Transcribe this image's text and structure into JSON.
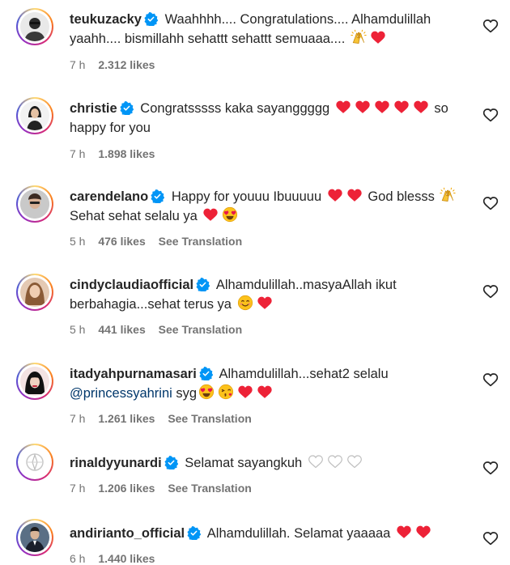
{
  "comments": [
    {
      "username": "teukuzacky",
      "text": "Waahhhh.... Congratulations.... Alhamdulillah yaahh.... bismillahh sehattt sehattt semuaaa....",
      "time": "7 h",
      "likes": "2.312 likes",
      "emoji": [
        "raised-hands",
        "heart"
      ]
    },
    {
      "username": "christie",
      "text": "Congratsssss kaka sayanggggg",
      "text_end": "so happy for you",
      "time": "7 h",
      "likes": "1.898 likes",
      "emoji": [
        "heart",
        "heart",
        "heart",
        "heart",
        "heart"
      ]
    },
    {
      "username": "carendelano",
      "text": "Happy for youuu Ibuuuuu",
      "text_mid": "God blesss",
      "text_end": "Sehat sehat selalu ya",
      "time": "5 h",
      "likes": "476 likes",
      "translate": "See Translation"
    },
    {
      "username": "cindyclaudiaofficial",
      "text": "Alhamdulillah..masyaAllah ikut berbahagia...sehat terus ya",
      "time": "5 h",
      "likes": "441 likes",
      "translate": "See Translation"
    },
    {
      "username": "itadyahpurnamasari",
      "text": "Alhamdulillah...sehat2 selalu",
      "mention": "@princessyahrini",
      "text_end": "syg",
      "time": "7 h",
      "likes": "1.261 likes",
      "translate": "See Translation"
    },
    {
      "username": "rinaldyyunardi",
      "text": "Selamat sayangkuh",
      "time": "7 h",
      "likes": "1.206 likes",
      "translate": "See Translation"
    },
    {
      "username": "andirianto_official",
      "text": "Alhamdulillah. Selamat yaaaaa",
      "time": "6 h",
      "likes": "1.440 likes"
    }
  ],
  "colors": {
    "text": "#262626",
    "meta": "#737373",
    "verified": "#0095f6",
    "heart": "#ed2237",
    "mention": "#00376b"
  },
  "icons": {
    "verified": "verified-badge-icon",
    "like": "heart-outline-icon"
  }
}
